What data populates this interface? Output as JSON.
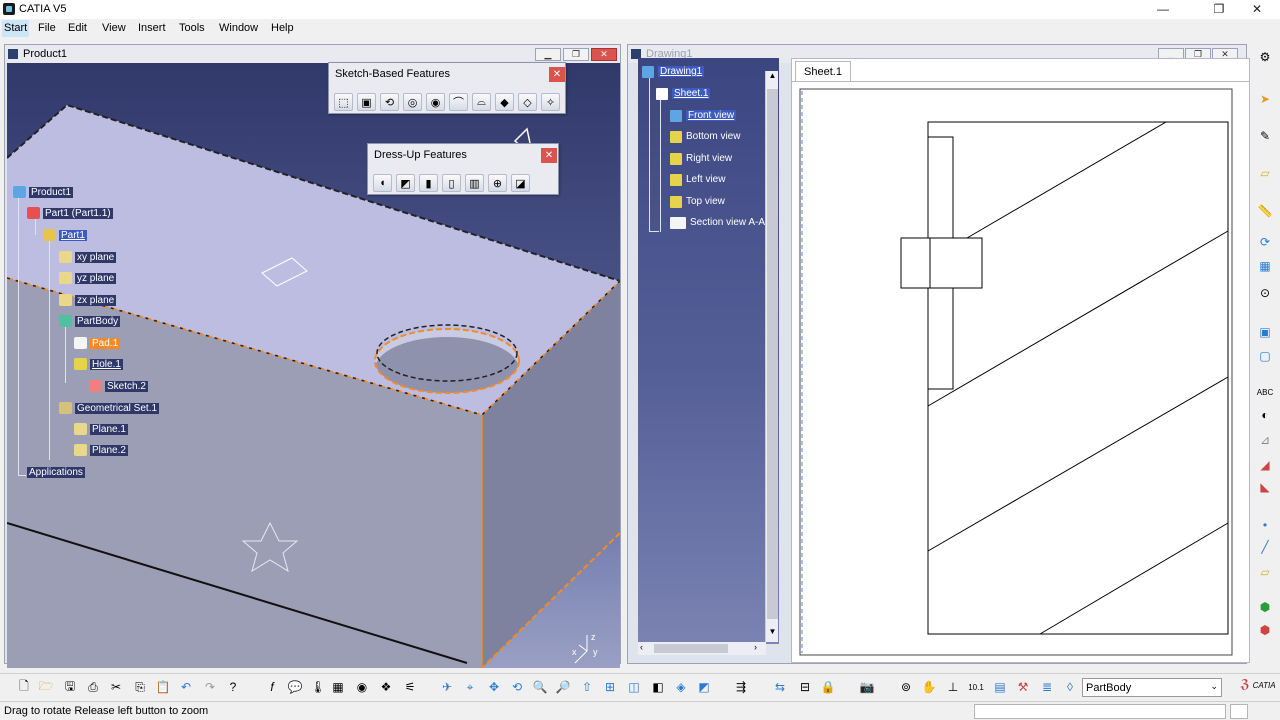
{
  "app": {
    "title": "CATIA V5"
  },
  "window_controls": {
    "minimize": "—",
    "maximize": "❐",
    "close": "✕"
  },
  "menu": [
    "Start",
    "File",
    "Edit",
    "View",
    "Insert",
    "Tools",
    "Window",
    "Help"
  ],
  "product_window": {
    "title": "Product1",
    "tree": {
      "root": "Product1",
      "part": "Part1 (Part1.1)",
      "part_body_root": "Part1",
      "planes": [
        "xy plane",
        "yz plane",
        "zx plane"
      ],
      "partbody": "PartBody",
      "pad": "Pad.1",
      "hole": "Hole.1",
      "sketch": "Sketch.2",
      "geoset": "Geometrical Set.1",
      "geoset_children": [
        "Plane.1",
        "Plane.2"
      ],
      "applications": "Applications"
    },
    "compass": {
      "x": "x",
      "y": "y",
      "z": "z"
    }
  },
  "sketch_toolbar": {
    "title": "Sketch-Based Features",
    "icons": [
      "pad-icon",
      "pocket-icon",
      "shaft-icon",
      "groove-icon",
      "hole-icon",
      "rib-icon",
      "slot-icon",
      "stiffener-icon",
      "multisection-icon",
      "removed-multisection-icon"
    ]
  },
  "dressup_toolbar": {
    "title": "Dress-Up Features",
    "icons": [
      "edge-fillet-icon",
      "chamfer-icon",
      "draft-icon",
      "shell-icon",
      "thickness-icon",
      "thread-icon",
      "remove-face-icon",
      "replace-face-icon"
    ]
  },
  "drawing_window": {
    "title": "Drawing1",
    "tree": {
      "root": "Drawing1",
      "sheet": "Sheet.1",
      "views": [
        "Front view",
        "Bottom view",
        "Right view",
        "Left view",
        "Top view"
      ],
      "section": "Section view A-A"
    },
    "sheet_tab": "Sheet.1"
  },
  "bottom_toolbar": {
    "combo_value": "PartBody",
    "catia_logo": "CATIA"
  },
  "status": {
    "message": "Drag to rotate  Release left button to zoom"
  },
  "colors": {
    "accent_orange": "#f48a26",
    "selection_blue": "#3d5ac2",
    "viewport_top": "#31386a"
  }
}
